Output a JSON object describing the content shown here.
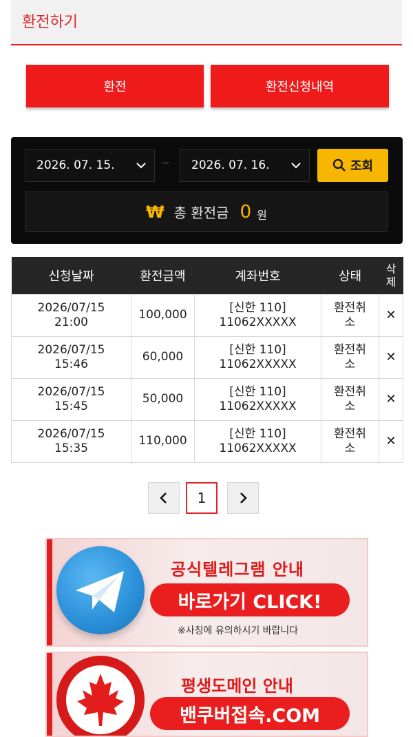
{
  "header": {
    "title": "환전하기"
  },
  "tabs": {
    "exchange_label": "환전",
    "history_label": "환전신청내역"
  },
  "search": {
    "date_from": "2026. 07. 15.",
    "date_to": "2026. 07. 16.",
    "separator": "~",
    "button_label": "조회"
  },
  "total": {
    "icon": "₩",
    "label": "총 환전금",
    "value": "0",
    "unit": "원"
  },
  "table": {
    "headers": [
      "신청날짜",
      "환전금액",
      "계좌번호",
      "상태",
      "삭제"
    ],
    "rows": [
      {
        "date": "2026/07/15",
        "time": "21:00",
        "amount": "100,000",
        "bank": "[신한 110]",
        "account": "11062XXXXX",
        "status_1": "환전취",
        "status_2": "소",
        "delete": "✕"
      },
      {
        "date": "2026/07/15",
        "time": "15:46",
        "amount": "60,000",
        "bank": "[신한 110]",
        "account": "11062XXXXX",
        "status_1": "환전취",
        "status_2": "소",
        "delete": "✕"
      },
      {
        "date": "2026/07/15",
        "time": "15:45",
        "amount": "50,000",
        "bank": "[신한 110]",
        "account": "11062XXXXX",
        "status_1": "환전취",
        "status_2": "소",
        "delete": "✕"
      },
      {
        "date": "2026/07/15",
        "time": "15:35",
        "amount": "110,000",
        "bank": "[신한 110]",
        "account": "11062XXXXX",
        "status_1": "환전취",
        "status_2": "소",
        "delete": "✕"
      }
    ]
  },
  "pagination": {
    "prev": "‹",
    "current": "1",
    "next": "›"
  },
  "banners": {
    "telegram": {
      "title": "공식텔레그램 안내",
      "cta": "바로가기 CLICK!",
      "note": "※사칭에 유의하시기 바랍니다"
    },
    "domain": {
      "title": "평생도메인 안내",
      "cta": "밴쿠버접속.COM"
    }
  },
  "colors": {
    "accent_red": "#e0262b",
    "button_red": "#ef1b1b",
    "gold": "#f7b600",
    "panel_dark": "#0b0b0b"
  }
}
